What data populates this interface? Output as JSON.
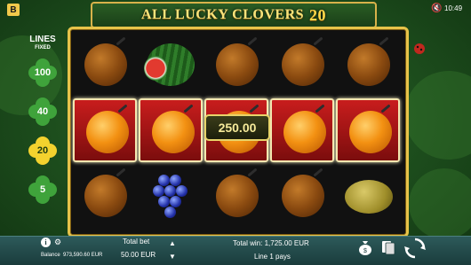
{
  "brand": {
    "logo_letter": "B"
  },
  "header": {
    "title": "ALL LUCKY CLOVERS",
    "title_number": "20"
  },
  "status": {
    "time": "10:49",
    "sound_icon": "speaker-muted-icon"
  },
  "lines_panel": {
    "title": "LINES",
    "subtitle": "FIXED",
    "options": [
      "100",
      "40",
      "20",
      "5"
    ],
    "selected": "20"
  },
  "reels": {
    "rows": [
      [
        "orange",
        "watermelon",
        "orange",
        "orange",
        "orange"
      ],
      [
        "orange",
        "orange",
        "orange",
        "orange",
        "orange"
      ],
      [
        "orange",
        "grapes",
        "orange",
        "orange",
        "lemon"
      ]
    ],
    "winning_row": 1,
    "win_amount": "250.00"
  },
  "footer": {
    "balance_label": "Balance",
    "balance_value": "973,590.60 EUR",
    "total_bet_label": "Total bet",
    "total_bet_value": "50.00 EUR",
    "total_win_label": "Total win: 1,725.00 EUR",
    "pays_text": "Line 1 pays"
  },
  "colors": {
    "frame_gold": "#e7c34a",
    "win_cell_red": "#c81d1d",
    "bar_teal": "#2d5a5a"
  }
}
